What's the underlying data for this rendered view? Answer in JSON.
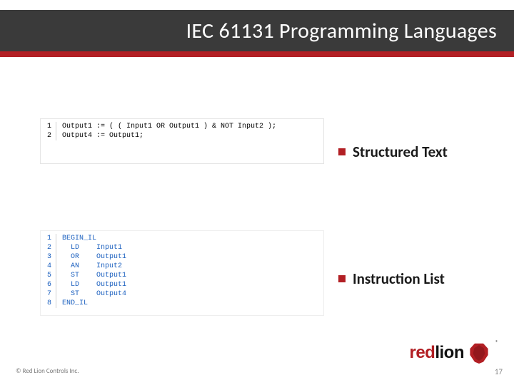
{
  "header": {
    "title": "IEC 61131 Programming Languages"
  },
  "panels": {
    "structured_text": {
      "label": "Structured Text",
      "gutter": "1\n2",
      "code": "Output1 := ( ( Input1 OR Output1 ) & NOT Input2 );\nOutput4 := Output1;"
    },
    "instruction_list": {
      "label": "Instruction List",
      "gutter": "1\n2\n3\n4\n5\n6\n7\n8",
      "code": "BEGIN_IL\n  LD    Input1\n  OR    Output1\n  AN    Input2\n  ST    Output1\n  LD    Output1\n  ST    Output4\nEND_IL"
    }
  },
  "footer": {
    "copyright": "© Red Lion Controls Inc.",
    "page": "17"
  },
  "logo": {
    "brand_red": "red",
    "brand_lion": "lion",
    "registered": "®"
  }
}
